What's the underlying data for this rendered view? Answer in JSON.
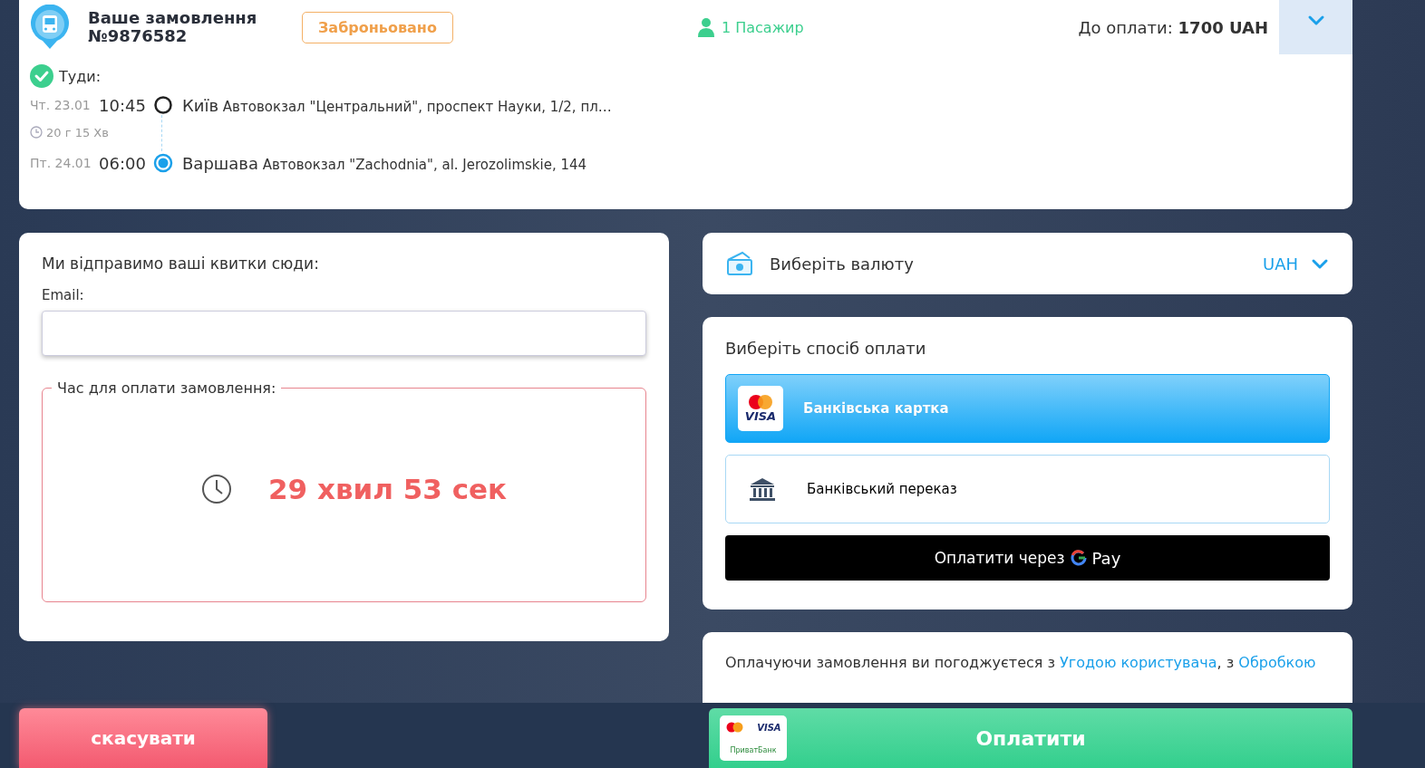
{
  "order": {
    "title": "Ваше замовлення",
    "number": "№9876582",
    "status": "Заброньовано",
    "passengers": "1 Пасажир",
    "amount_label": "До оплати:",
    "amount": "1700 UAH",
    "expanded": false
  },
  "trip": {
    "direction": "Туди:",
    "duration": "20 г 15 Хв",
    "stops": [
      {
        "kind": "departure",
        "date": "Чт. 23.01",
        "time": "10:45",
        "city": "Київ",
        "address": "Автовокзал \"Центральний\", проспект Науки, 1/2, пл…"
      },
      {
        "kind": "arrival",
        "date": "Пт. 24.01",
        "time": "06:00",
        "city": "Варшава",
        "address": "Автовокзал \"Zachodnia\", al. Jerozolimskie, 144"
      }
    ]
  },
  "contact": {
    "heading": "Ми відправимо ваші квитки сюди:",
    "email_label": "Email:"
  },
  "timer": {
    "legend": "Час для оплати замовлення:",
    "remaining": "29 хвил 53 сек"
  },
  "currency": {
    "label": "Виберіть валюту",
    "value": "UAH"
  },
  "payment": {
    "heading": "Виберіть спосіб оплати",
    "methods": [
      {
        "kind": "card",
        "label": "Банківська картка",
        "logo_text": "VISA",
        "selected": true
      },
      {
        "kind": "transfer",
        "label": "Банківський переказ",
        "selected": false
      }
    ],
    "gpay": {
      "label": "Оплатити через",
      "brand": "Pay"
    }
  },
  "terms": {
    "text": "Оплачуючи замовлення ви погоджуєтеся з ",
    "links": [
      "Угодою користувача",
      "Обробкою"
    ],
    "between": ", з "
  },
  "footer": {
    "cancel": "скасувати",
    "pay": "Оплатити",
    "logos": [
      "VISA",
      "ПриватБанк"
    ]
  }
}
